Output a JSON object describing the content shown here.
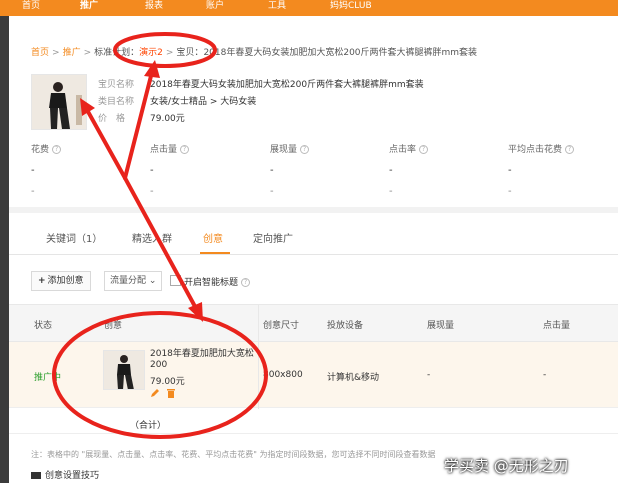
{
  "topnav": {
    "items": [
      "首页",
      "推广",
      "报表",
      "账户",
      "工具",
      "妈妈CLUB"
    ],
    "active_index": 1,
    "accent": "#f38a1f"
  },
  "breadcrumb": {
    "home": "首页",
    "promo": "推广",
    "plan_label": "标准计划：",
    "plan_name": "演示2",
    "item_label": "宝贝：",
    "item_name": "2018年春夏大码女装加肥加大宽松200斤两件套大裤腿裤胖mm套装"
  },
  "product": {
    "title_label": "宝贝名称",
    "title": "2018年春夏大码女装加肥加大宽松200斤两件套大裤腿裤胖mm套装",
    "category_label": "类目名称",
    "category": "女装/女士精品 > 大码女装",
    "price_label": "价　格",
    "price": "79.00元"
  },
  "metrics": [
    {
      "label": "花费",
      "value": "-",
      "value2": "-"
    },
    {
      "label": "点击量",
      "value": "-",
      "value2": "-"
    },
    {
      "label": "展现量",
      "value": "-",
      "value2": "-"
    },
    {
      "label": "点击率",
      "value": "-",
      "value2": "-"
    },
    {
      "label": "平均点击花费",
      "value": "-",
      "value2": "-"
    }
  ],
  "tabs": [
    "关键词（1）",
    "精选人群",
    "创意",
    "定向推广"
  ],
  "active_tab": 2,
  "toolbar": {
    "add_label": "添加创意",
    "flow_label": "流量分配",
    "smart_title_label": "开启智能标题"
  },
  "table": {
    "headers": [
      "状态",
      "创意",
      "创意尺寸",
      "投放设备",
      "展现量",
      "点击量"
    ],
    "row": {
      "status": "推广中",
      "title": "2018年春夏加肥加大宽松200",
      "price": "79.00元",
      "size": "800x800",
      "device": "计算机&移动",
      "impressions": "-",
      "clicks": "-"
    },
    "total_label": "（合计）"
  },
  "note": "注：表格中的 \"展现量、点击量、点击率、花费、平均点击花费\" 为指定时间段数据，您可选择不同时间段查看数据",
  "tips_label": "创意设置技巧",
  "watermark": "学买卖 @无形之刃",
  "colors": {
    "accent": "#f38a1f",
    "annotation": "#e8231c",
    "status": "#2a9d2a"
  }
}
